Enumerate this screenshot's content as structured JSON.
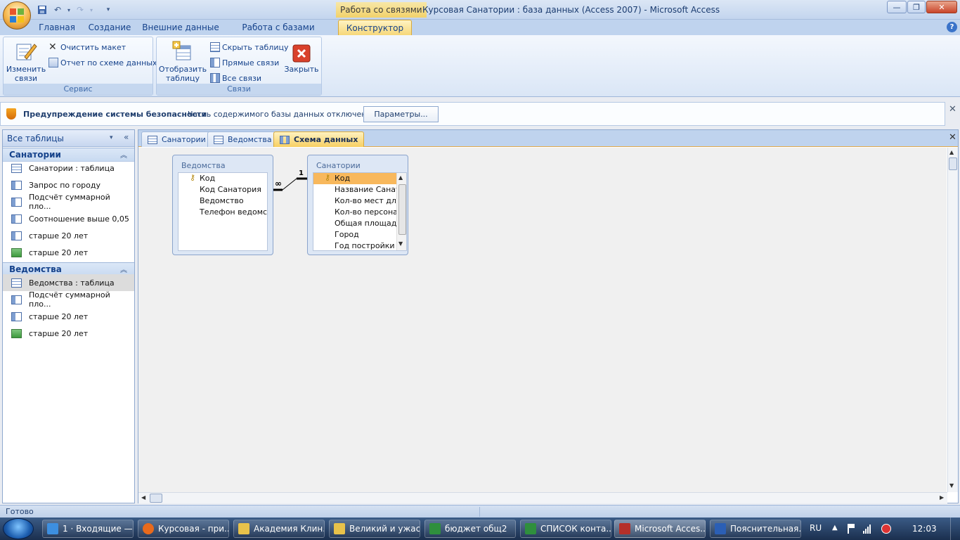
{
  "titlebar": {
    "context_title": "Работа со связями",
    "window_title": "Курсовая Санатории : база данных (Access 2007) - Microsoft Access",
    "minimize": "—",
    "restore": "❐",
    "close": "✕"
  },
  "ribbon_tabs": [
    "Главная",
    "Создание",
    "Внешние данные",
    "Работа с базами данных",
    "Конструктор"
  ],
  "ribbon": {
    "group_service": {
      "label": "Сервис",
      "edit_relations": "Изменить связи",
      "clear_layout": "Очистить макет",
      "relation_report": "Отчет по схеме данных"
    },
    "group_relations": {
      "label": "Связи",
      "show_table": "Отобразить таблицу",
      "hide_table": "Скрыть таблицу",
      "direct_relations": "Прямые связи",
      "all_relations": "Все связи",
      "close": "Закрыть"
    }
  },
  "security_bar": {
    "title": "Предупреждение системы безопасности",
    "message": "Часть содержимого базы данных отключено",
    "options_button": "Параметры..."
  },
  "nav_pane": {
    "title": "Все таблицы",
    "groups": [
      {
        "name": "Санатории",
        "items": [
          {
            "label": "Санатории : таблица",
            "kind": "table"
          },
          {
            "label": "Запрос по городу",
            "kind": "query"
          },
          {
            "label": "Подсчёт суммарной пло...",
            "kind": "query"
          },
          {
            "label": "Соотношение выше 0,05",
            "kind": "query"
          },
          {
            "label": "старше 20 лет",
            "kind": "query"
          },
          {
            "label": "старше 20 лет",
            "kind": "report"
          }
        ]
      },
      {
        "name": "Ведомства",
        "items": [
          {
            "label": "Ведомства : таблица",
            "kind": "table"
          },
          {
            "label": "Подсчёт суммарной пло...",
            "kind": "query"
          },
          {
            "label": "старше 20 лет",
            "kind": "query"
          },
          {
            "label": "старше 20 лет",
            "kind": "report"
          }
        ]
      }
    ]
  },
  "doc_tabs": [
    "Санатории",
    "Ведомства",
    "Схема данных"
  ],
  "diagram": {
    "tables": [
      {
        "name": "Ведомства",
        "fields": [
          "Код",
          "Код Санатория",
          "Ведомство",
          "Телефон ведомства"
        ]
      },
      {
        "name": "Санатории",
        "fields": [
          "Код",
          "Название Санатория",
          "Кол-во мест для",
          "Кол-во персонала",
          "Общая площадь",
          "Город",
          "Год постройки"
        ]
      }
    ],
    "relation": {
      "many_label": "∞",
      "one_label": "1"
    }
  },
  "status": "Готово",
  "taskbar": {
    "items": [
      "1 · Входящие —...",
      "Курсовая - при...",
      "Академия Клин...",
      "Великий и ужас...",
      "бюджет общ2",
      "СПИСОК конта...",
      "Microsoft Acces...",
      "Пояснительная..."
    ],
    "lang": "RU",
    "time": "12:03"
  }
}
